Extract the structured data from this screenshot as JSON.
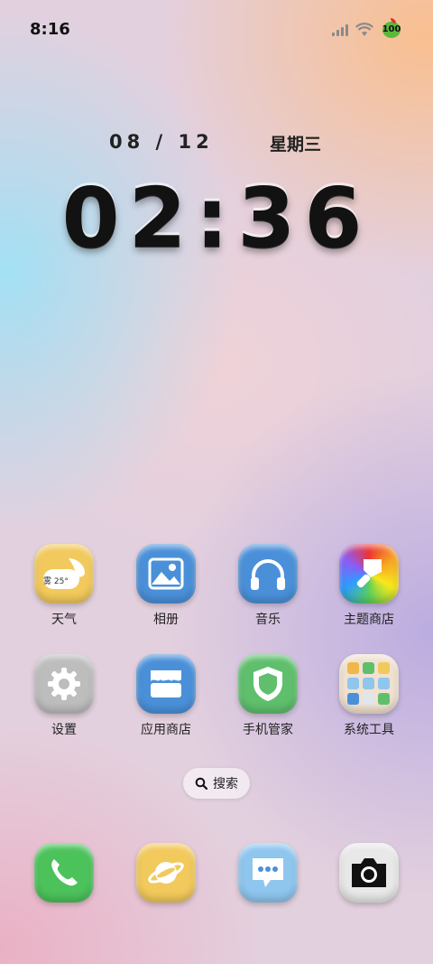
{
  "status": {
    "time": "8:16",
    "battery": "100"
  },
  "lock": {
    "date": "08 / 12",
    "weekday": "星期三",
    "clock": "02:36"
  },
  "apps": [
    {
      "label": "天气",
      "weather_text": "雾 25°",
      "color": "#f2c95c"
    },
    {
      "label": "相册",
      "color": "#4a90d9"
    },
    {
      "label": "音乐",
      "color": "#4a90d9"
    },
    {
      "label": "主题商店",
      "color": "#e44"
    },
    {
      "label": "设置",
      "color": "#b8b8b8"
    },
    {
      "label": "应用商店",
      "color": "#4a90d9"
    },
    {
      "label": "手机管家",
      "color": "#5fbf6d"
    },
    {
      "label": "系统工具",
      "color": "#f0e1d0"
    }
  ],
  "search": {
    "label": "搜索"
  },
  "dock": [
    {
      "name": "phone",
      "color": "#4cc25b"
    },
    {
      "name": "browser",
      "color": "#f2c95c"
    },
    {
      "name": "messages",
      "color": "#8fc6ee"
    },
    {
      "name": "camera",
      "color": "#e8e8e8"
    }
  ]
}
